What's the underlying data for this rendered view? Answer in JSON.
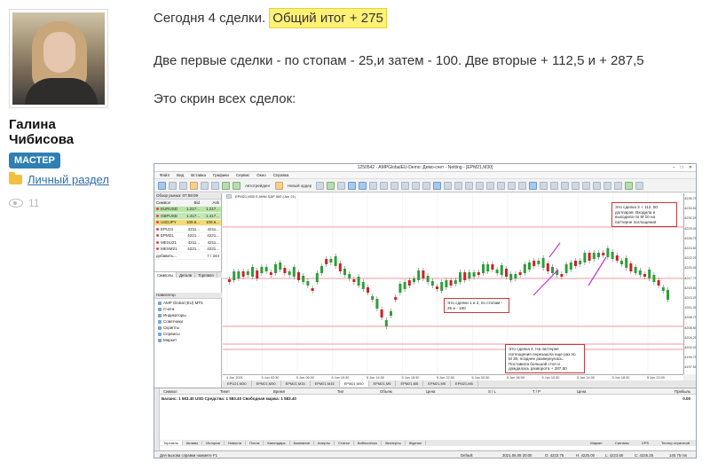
{
  "author": {
    "name_line1": "Галина",
    "name_line2": "Чибисова",
    "badge": "МАСТЕР",
    "personal_link": "Личный раздел",
    "views": "11"
  },
  "post": {
    "line1_prefix": "Сегодня 4 сделки.",
    "line1_highlight": "Общий итог + 275",
    "line2": "Две первые сделки - по стопам - 25,и затем - 100. Две вторые + 112,5 и + 287,5",
    "line3": "Это скрин всех сделок:"
  },
  "terminal": {
    "title": "1250542 - AMPGlobalEU-Demo: Демо-счет - Netting - [EPM21,M30]",
    "menu": [
      "Файл",
      "Вид",
      "Вставка",
      "Графики",
      "Сервис",
      "Окно",
      "Справка"
    ],
    "toolbar_labels": [
      "Автотрейдинг",
      "Новый ордер"
    ],
    "market_watch": {
      "header": "Обзор рынка: 07:59:09",
      "col_symbol": "Символ",
      "col_bid": "Bid",
      "col_ask": "Ask",
      "rows": [
        {
          "symbol": "EURUSD",
          "bid": "1.217...",
          "ask": "1.217...",
          "style": "hl"
        },
        {
          "symbol": "GBPUSD",
          "bid": "1.417...",
          "ask": "1.417...",
          "style": "hl2"
        },
        {
          "symbol": "USDJPY",
          "bid": "109.6...",
          "ask": "109.6...",
          "style": "hl3"
        },
        {
          "symbol": "EPU21",
          "bid": "4211...",
          "ask": "4211...",
          "style": ""
        },
        {
          "symbol": "EPM21",
          "bid": "4221...",
          "ask": "4221...",
          "style": ""
        },
        {
          "symbol": "MESU21",
          "bid": "4211...",
          "ask": "4211...",
          "style": ""
        },
        {
          "symbol": "MESM21",
          "bid": "4221...",
          "ask": "4221...",
          "style": ""
        },
        {
          "symbol": "добавить...",
          "bid": "",
          "ask": "7 / 344",
          "style": ""
        }
      ],
      "tabs": [
        "Символы",
        "Детали",
        "Торговля"
      ]
    },
    "navigator": {
      "header": "Навигатор",
      "items": [
        "AMP Global (EU) MT5",
        "Счета",
        "Индикаторы",
        "Советники",
        "Скрипты",
        "Сервисы",
        "Маркет"
      ],
      "tabs": [
        "Общие",
        "Избранное"
      ]
    },
    "chart": {
      "header": "EPM21,M30  E-MINI S&P 500 (Jun 21)",
      "price_labels": [
        "4235.75",
        "4233.50",
        "4231.25",
        "4229.00",
        "4226.75",
        "4224.50",
        "4222.25",
        "4220.00",
        "4217.75",
        "4215.50",
        "4213.25",
        "4211.00",
        "4208.75",
        "4206.50",
        "4204.25",
        "4202.00",
        "4199.75",
        "4197.50"
      ],
      "time_labels": [
        "4 Jun 2021",
        "5 Jun 02:30",
        "5 Jun 06:30",
        "5 Jun 10:30",
        "5 Jun 14:30",
        "5 Jun 18:30",
        "5 Jun 22:30",
        "5 Jun 02:30",
        "5 Jun 06:30",
        "5 Jun 10:30",
        "5 Jun 14:30",
        "5 Jun 18:30",
        "5 Jun 22:00"
      ],
      "tabs": [
        "EPU21,M30",
        "EPM21,M30",
        "EPM21,M15",
        "EPM21,M15",
        "EPM21,M30",
        "EPM21,M5",
        "EPM21,M5",
        "EPM21,M5",
        "EPM21,M5"
      ],
      "active_tab_index": 4,
      "callouts": {
        "c1": "Это сделки 1 и 2, по стопам - 25 и - 100",
        "c2_l1": "Это сделка 3 + 112. 50",
        "c2_l2": "долларов. Входила и",
        "c2_l3": "выходила по М 10 на",
        "c2_l4": "паттерне поглощения",
        "c3_l1": "Это сделка 4. На паттерне",
        "c3_l2": "поглощения перезашла еще раз по",
        "c3_l3": "М 30, позднее развернулась.",
        "c3_l4": "Поставила большой стоп и",
        "c3_l5": "дождалась разворота + 287,50"
      },
      "colors": {
        "bull": "#2e9e3a",
        "bear": "#d21f26",
        "level": "#e0383e",
        "arrow": "#c636d1"
      }
    },
    "toolbox": {
      "columns": [
        "Символ",
        "Тикет",
        "Время",
        "Тип",
        "Объем",
        "Цена",
        "S / L",
        "T / P",
        "Цена",
        "Прибыль"
      ],
      "balance_line": "Баланс: 1 583.40 USD  Средства: 1 583.40  Свободная маржа: 1 583.40",
      "profit": "0.00",
      "tabs": [
        "Торговля",
        "Активы",
        "История",
        "Новости",
        "Почта",
        "Календарь",
        "Компания",
        "Алерты",
        "Статьи",
        "Библиотека",
        "Эксперты",
        "Журнал"
      ],
      "right_tabs": [
        "Маркет",
        "Сигналы",
        "VPS",
        "Тестер стратегий"
      ]
    },
    "status": {
      "help": "Для вызова справки нажмите F1",
      "profile": "Default",
      "datetime": "2021.06.08 20:00",
      "o": "O: 4223.75",
      "h": "H: 4225.00",
      "l": "L: 4223.50",
      "c": "C: 4225.25",
      "traffic": "140.75 ms"
    }
  }
}
